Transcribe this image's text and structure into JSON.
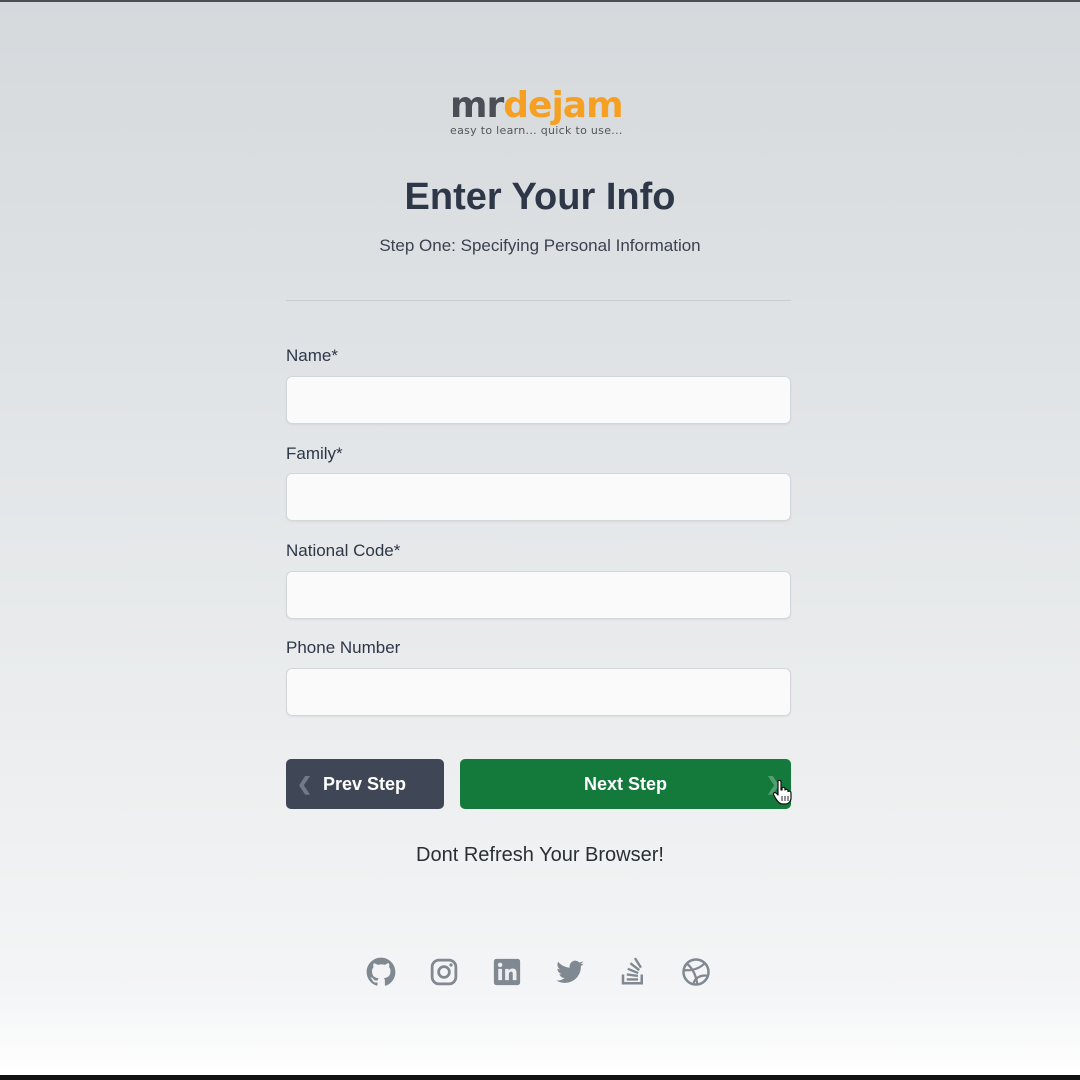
{
  "brand": {
    "name_part1": "mr",
    "name_part2": "dejam",
    "tagline": "easy to learn... quick to use..."
  },
  "header": {
    "title": "Enter Your Info",
    "subtitle": "Step One: Specifying Personal Information"
  },
  "form": {
    "fields": [
      {
        "label": "Name*",
        "value": ""
      },
      {
        "label": "Family*",
        "value": ""
      },
      {
        "label": "National Code*",
        "value": ""
      },
      {
        "label": "Phone Number",
        "value": ""
      }
    ],
    "prev_label": "Prev Step",
    "next_label": "Next Step"
  },
  "warning": "Dont Refresh Your Browser!",
  "socials": [
    "github-icon",
    "instagram-icon",
    "linkedin-icon",
    "twitter-icon",
    "stackoverflow-icon",
    "dribbble-icon"
  ],
  "colors": {
    "brand_orange": "#f5a023",
    "next_button": "#137a3c",
    "prev_button": "#3f4756",
    "social_icon": "#808891"
  }
}
